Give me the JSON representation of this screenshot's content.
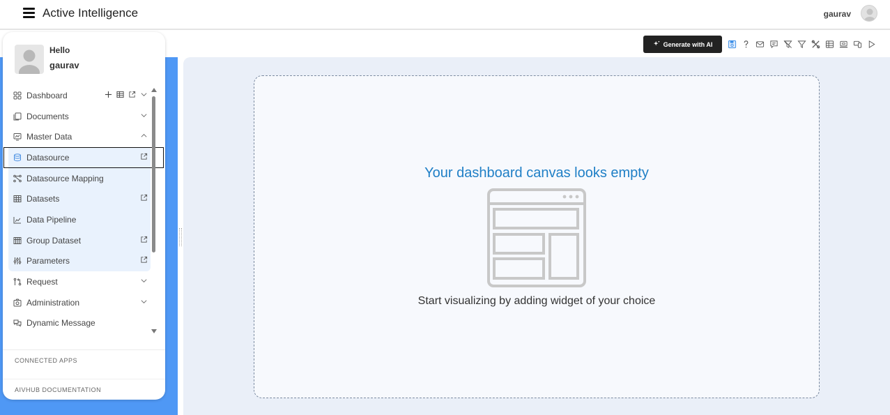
{
  "header": {
    "app_title": "Active Intelligence",
    "menu_icon": "hamburger-icon",
    "user_name": "gaurav",
    "user_avatar_icon": "user-avatar-icon"
  },
  "toolbar": {
    "generate_ai_label": "Generate with AI",
    "generate_ai_icon": "sparkle-icon",
    "icons": [
      {
        "name": "save-icon",
        "color": "#3b8ee8"
      },
      {
        "name": "help-icon",
        "color": "#555555"
      },
      {
        "name": "mail-icon",
        "color": "#555555"
      },
      {
        "name": "comment-icon",
        "color": "#555555"
      },
      {
        "name": "clear-filter-icon",
        "color": "#555555"
      },
      {
        "name": "filter-icon",
        "color": "#555555"
      },
      {
        "name": "tools-icon",
        "color": "#555555"
      },
      {
        "name": "table-icon",
        "color": "#555555"
      },
      {
        "name": "screen-icon",
        "color": "#555555"
      },
      {
        "name": "devices-icon",
        "color": "#555555"
      },
      {
        "name": "play-icon",
        "color": "#555555"
      }
    ]
  },
  "sidebar": {
    "greeting": "Hello",
    "user_name": "gaurav",
    "items": [
      {
        "label": "Dashboard",
        "icon": "dashboard-icon",
        "actions": [
          "plus-icon",
          "table-icon",
          "external-link-icon",
          "chevron-down-icon"
        ]
      },
      {
        "label": "Documents",
        "icon": "documents-icon",
        "actions": [
          "chevron-down-icon"
        ]
      },
      {
        "label": "Master Data",
        "icon": "master-data-icon",
        "actions": [
          "chevron-up-icon"
        ],
        "expanded": true,
        "children": [
          {
            "label": "Datasource",
            "icon": "database-icon",
            "actions": [
              "external-link-icon"
            ],
            "selected": true
          },
          {
            "label": "Datasource Mapping",
            "icon": "mapping-icon",
            "actions": []
          },
          {
            "label": "Datasets",
            "icon": "grid-icon",
            "actions": [
              "external-link-icon"
            ]
          },
          {
            "label": "Data Pipeline",
            "icon": "line-chart-icon",
            "actions": []
          },
          {
            "label": "Group Dataset",
            "icon": "group-grid-icon",
            "actions": [
              "external-link-icon"
            ]
          },
          {
            "label": "Parameters",
            "icon": "sliders-icon",
            "actions": [
              "external-link-icon"
            ]
          }
        ]
      },
      {
        "label": "Request",
        "icon": "request-icon",
        "actions": [
          "chevron-down-icon"
        ]
      },
      {
        "label": "Administration",
        "icon": "administration-icon",
        "actions": [
          "chevron-down-icon"
        ]
      },
      {
        "label": "Dynamic Message",
        "icon": "message-icon",
        "actions": []
      }
    ],
    "footer": {
      "connected_apps": "CONNECTED APPS",
      "documentation": "AIVHUB DOCUMENTATION"
    }
  },
  "canvas": {
    "empty_title": "Your dashboard canvas looks empty",
    "empty_subtitle": "Start visualizing by adding widget of your choice",
    "illustration_icon": "empty-dashboard-icon"
  },
  "colors": {
    "accent_blue": "#4f98f5",
    "title_blue": "#1f7fc6",
    "canvas_bg": "#eaeff8",
    "selected_bg": "#e9f2fd"
  }
}
